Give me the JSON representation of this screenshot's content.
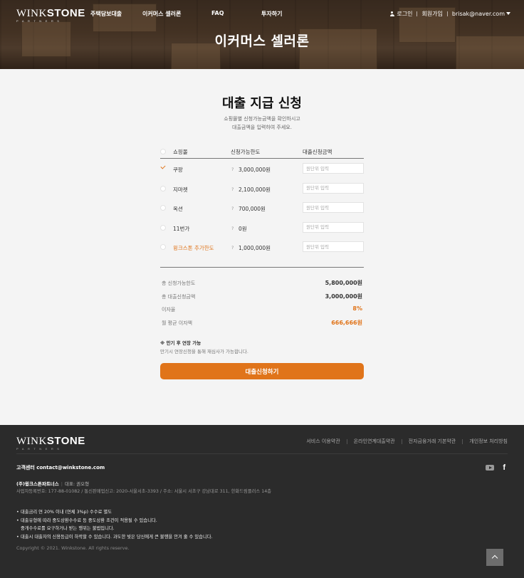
{
  "brand": {
    "name_light": "WINK",
    "name_bold": "STONE",
    "tagline": "PARTNERS"
  },
  "nav": {
    "items": [
      {
        "label": "주택담보대출"
      },
      {
        "label": "이커머스 셀러론"
      },
      {
        "label": "FAQ"
      },
      {
        "label": "투자하기"
      }
    ],
    "login": "로그인",
    "signup": "회원가입",
    "user_email": "brisak@naver.com"
  },
  "hero": {
    "title": "이커머스 셀러론"
  },
  "main": {
    "title": "대출 지급 신청",
    "desc_line1": "쇼핑몰별 신청가능금액을 확인하시고",
    "desc_line2": "대출금액을 입력하여 주세요."
  },
  "table": {
    "headers": {
      "mall": "쇼핑몰",
      "available": "신청가능한도",
      "request": "대출신청금액"
    },
    "input_placeholder": "원단위 입력",
    "rows": [
      {
        "mall": "쿠팡",
        "available": "3,000,000원",
        "checked": true
      },
      {
        "mall": "지마켓",
        "available": "2,100,000원",
        "checked": false
      },
      {
        "mall": "옥션",
        "available": "700,000원",
        "checked": false
      },
      {
        "mall": "11번가",
        "available": "0원",
        "checked": false
      },
      {
        "mall": "윙크스톤 추가한도",
        "available": "1,000,000원",
        "checked": false
      }
    ]
  },
  "summary": {
    "total_available_label": "총 신청가능한도",
    "total_available": "5,800,000원",
    "total_request_label": "총 대출신청금액",
    "total_request": "3,000,000원",
    "rate_label": "이자율",
    "rate": "8%",
    "monthly_label": "월 평균 이자액",
    "monthly": "666,666원"
  },
  "note": {
    "title": "※ 만기 후 연장 가능",
    "text": "만기시 연장신청을 통해 재심사가 가능합니다."
  },
  "apply_button": "대출신청하기",
  "footer": {
    "links": [
      "서비스 이용약관",
      "온라인연계대출약관",
      "전자금융거래 기본약관",
      "개인정보 처리방침"
    ],
    "contact": "고객센터 contact@winkstone.com",
    "company_name": "(주)윙크스톤파트너스",
    "ceo": "대표: 권오형",
    "biz_info": "사업자등록번호: 177-88-01082 / 통신판매업신고: 2020-서울서초-3393 / 주소: 서울시 서초구 강남대로 311, 한화드림플러스 14층",
    "notices": [
      "대출금리 연 20% 이내 (연체 3%p) 수수료 별도",
      "대출유형에 따라 중도상환수수료 등 중도상환 조건이 적용될 수 있습니다.",
      "중개수수료를 요구하거나 받는 행위는 불법입니다.",
      "대출시 대출자의 신용등급이 하락할 수 있습니다. 과도한 빚은 당신에게 큰 불행을 안겨 줄 수 있습니다."
    ],
    "copyright": "Copyright © 2021. Winkstone. All rights reserve."
  },
  "colors": {
    "accent": "#e0741a",
    "footer_bg": "#2b2b2b"
  }
}
